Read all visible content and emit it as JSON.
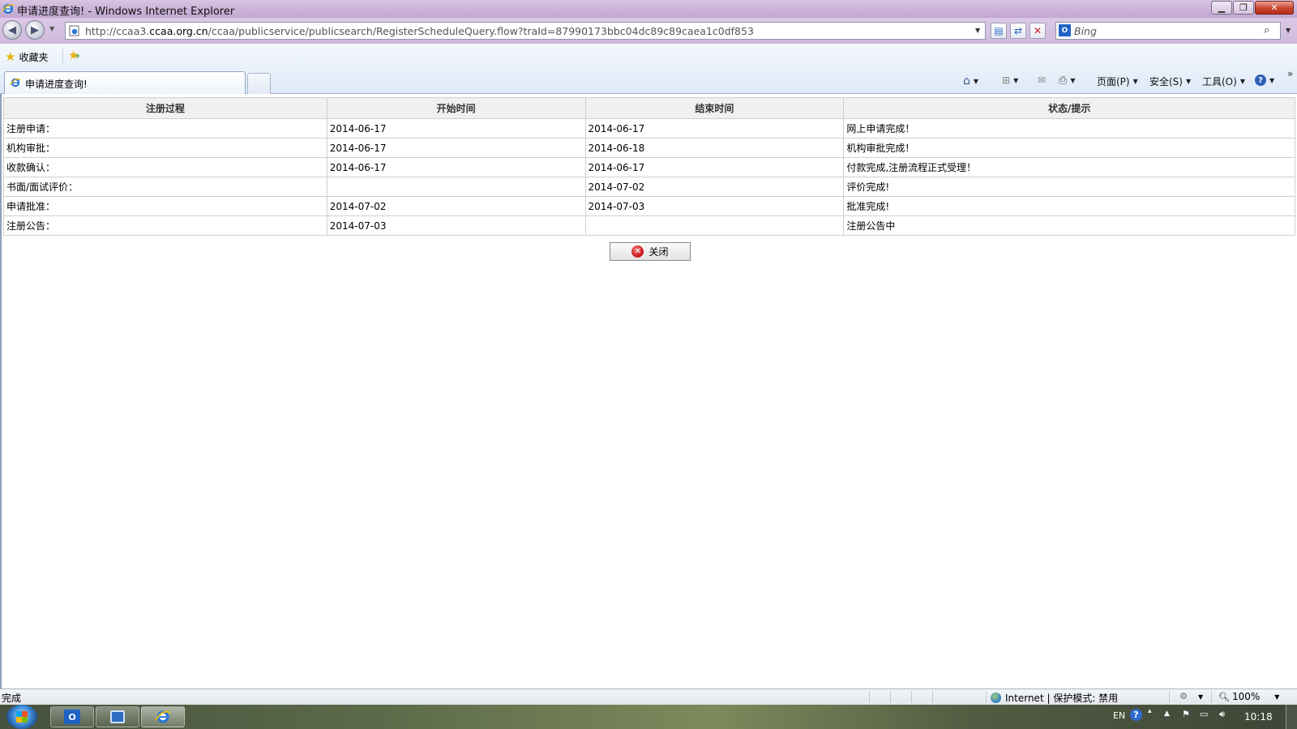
{
  "window": {
    "title": "申请进度查询! - Windows Internet Explorer"
  },
  "address_bar": {
    "url_prefix": "http://ccaa3.",
    "url_host": "ccaa.org.cn",
    "url_path": "/ccaa/publicservice/publicsearch/RegisterScheduleQuery.flow?traId=87990173bbc04dc89c89caea1c0df853"
  },
  "search": {
    "placeholder": "Bing"
  },
  "favorites_bar": {
    "favorites_label": "收藏夹"
  },
  "tab": {
    "title": "申请进度查询!"
  },
  "command_bar": {
    "page_label": "页面(P)",
    "safety_label": "安全(S)",
    "tools_label": "工具(O)",
    "more": "»"
  },
  "table": {
    "headers": [
      "注册过程",
      "开始时间",
      "结束时间",
      "状态/提示"
    ],
    "rows": [
      [
        "注册申请：",
        "2014-06-17",
        "2014-06-17",
        "网上申请完成！"
      ],
      [
        "机构审批：",
        "2014-06-17",
        "2014-06-18",
        "机构审批完成！"
      ],
      [
        "收款确认：",
        "2014-06-17",
        "2014-06-17",
        "付款完成,注册流程正式受理！"
      ],
      [
        "书面/面试评价：",
        "",
        "2014-07-02",
        "评价完成!"
      ],
      [
        "申请批准：",
        "2014-07-02",
        "2014-07-03",
        "批准完成!"
      ],
      [
        "注册公告：",
        "2014-07-03",
        "",
        "注册公告中"
      ]
    ]
  },
  "close_button": {
    "label": "关闭"
  },
  "status_bar": {
    "status": "完成",
    "zone": "Internet | 保护模式: 禁用",
    "zoom": "100%"
  },
  "taskbar": {
    "lang": "EN",
    "clock": "10:18"
  },
  "colors": {
    "title_bar": "#c9b0d6",
    "header_bg": "#f0f0f0",
    "close_icon": "#d01919"
  }
}
